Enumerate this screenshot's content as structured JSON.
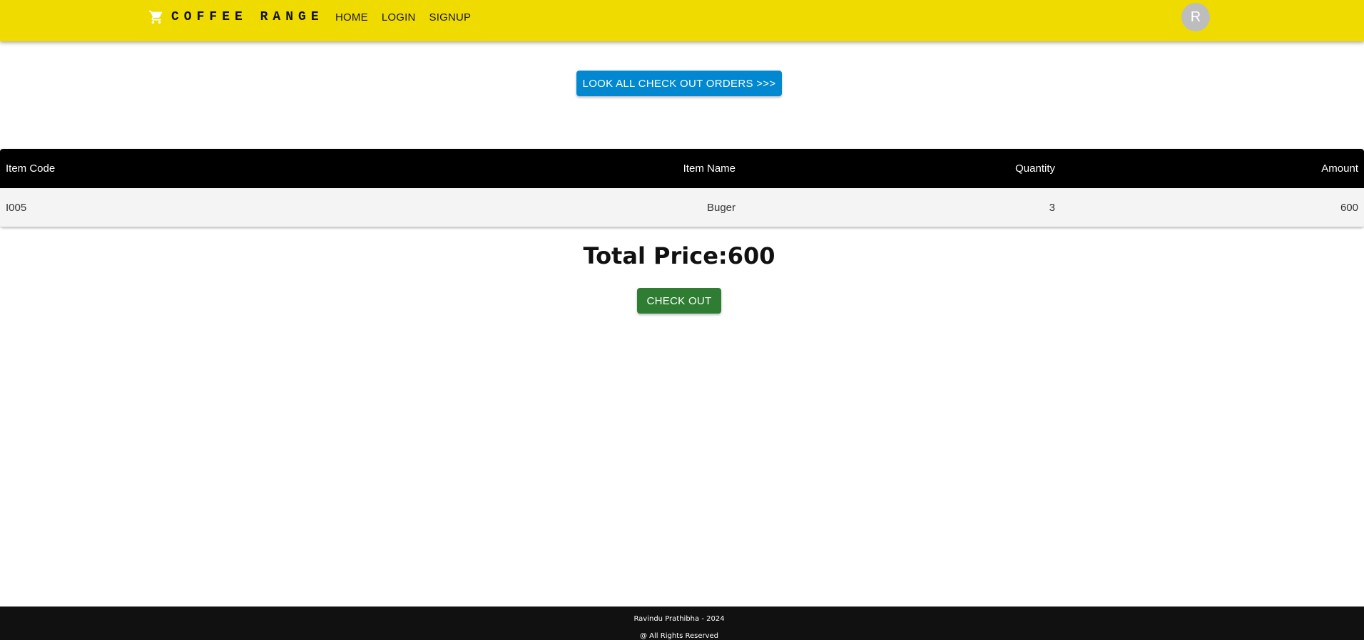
{
  "header": {
    "brand": "COFFEE RANGE",
    "nav": [
      "HOME",
      "LOGIN",
      "SIGNUP"
    ],
    "avatar_initial": "R",
    "background_color": "#f0db00"
  },
  "actions": {
    "look_all_orders": "LOOK ALL CHECK OUT ORDERS >>>",
    "look_all_orders_color": "#0288d1",
    "checkout": "CHECK OUT",
    "checkout_color": "#2e7d32"
  },
  "table": {
    "columns": [
      "Item Code",
      "Item Name",
      "Quantity",
      "Amount"
    ],
    "rows": [
      [
        "I005",
        "Buger",
        "3",
        "600"
      ]
    ]
  },
  "total_price": "Total Price:600",
  "footer": {
    "credit": "Ravindu Prathibha - 2024",
    "rights": "@ All Rights Reserved"
  }
}
